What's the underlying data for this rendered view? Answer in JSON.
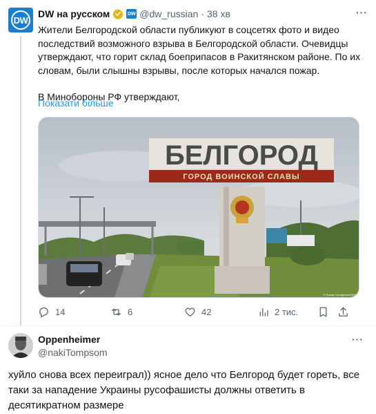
{
  "tweet": {
    "avatar_text": "DW",
    "author_name": "DW на русском",
    "handle": "@dw_russian",
    "separator": "·",
    "time": "38 хв",
    "more": "···",
    "text_para1": "Жители Белгородской области публикуют в соцсетях фото и видео последствий возможного взрыва в Белгородской области. Очевидцы утверждают, что горит склад боеприпасов в Ракитянском районе. По их словам, были слышны взрывы, после которых начался пожар.",
    "text_para2": "В Минобороны РФ утверждают,",
    "show_more": "Показати більше",
    "photo": {
      "sign_big": "БЕЛГОРОД",
      "sign_small": "ГОРОД ВОИНСКОЙ СЛАВЫ",
      "credit": "© Raulan Kovaljemov/HIND"
    },
    "actions": {
      "replies": "14",
      "retweets": "6",
      "likes": "42",
      "views": "2 тис."
    },
    "colors": {
      "accent": "#1d9bf0",
      "dw_blue": "#1a7fd0",
      "verified_gold": "#e2b719"
    }
  },
  "reply": {
    "author_name": "Oppenheimer",
    "handle": "@nakiTompsom",
    "more": "···",
    "body": "хуйло снова всех переиграл)) ясное дело что Белгород будет гореть, все таки за нападение Украины русофашисты должны ответить в десятикратном размере"
  }
}
